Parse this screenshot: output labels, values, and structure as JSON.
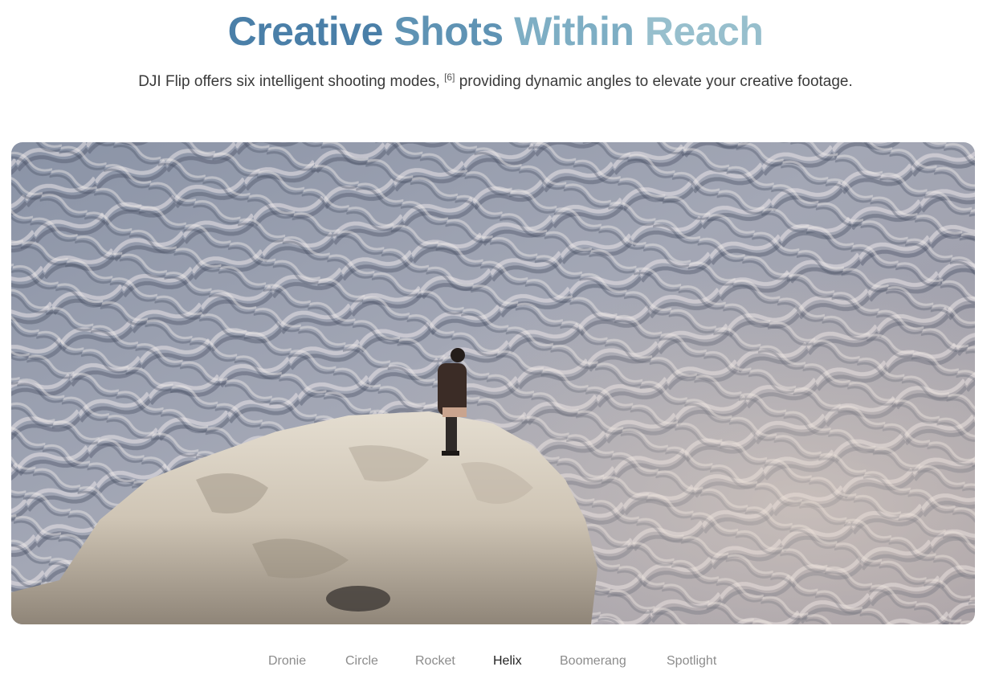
{
  "heading": {
    "word1": "Creative",
    "word2": "Shots",
    "word3": "Within",
    "word4": "Reach"
  },
  "subtitle": {
    "text_before": "DJI Flip offers six intelligent shooting modes, ",
    "footnote": "[6]",
    "text_after": " providing dynamic angles to elevate your creative footage."
  },
  "video": {
    "scene": "person-standing-on-rock-over-badlands"
  },
  "modes": {
    "items": [
      "Dronie",
      "Circle",
      "Rocket",
      "Helix",
      "Boomerang",
      "Spotlight"
    ],
    "active": "Helix"
  },
  "colors": {
    "heading_gradient": [
      "#4a7fa8",
      "#97bfcd"
    ],
    "active_mode": "#222222",
    "inactive_mode": "#8c8c8c"
  }
}
